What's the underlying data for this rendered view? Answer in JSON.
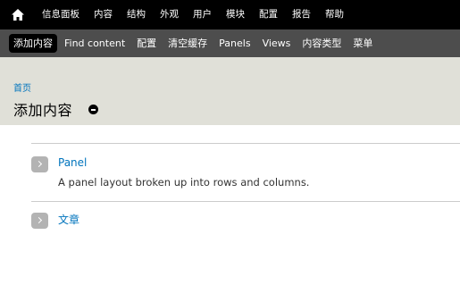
{
  "toolbar": {
    "home_icon": "home-icon",
    "items": [
      "信息面板",
      "内容",
      "结构",
      "外观",
      "用户",
      "模块",
      "配置",
      "报告",
      "帮助"
    ]
  },
  "shortcuts": {
    "items": [
      "添加内容",
      "Find content",
      "配置",
      "清空缓存",
      "Panels",
      "Views",
      "内容类型",
      "菜单"
    ],
    "active_index": 0
  },
  "header": {
    "breadcrumb": "首页",
    "title": "添加内容",
    "shortcut_icon": "remove-shortcut-icon"
  },
  "content": {
    "items": [
      {
        "title": "Panel",
        "description": "A panel layout broken up into rows and columns."
      },
      {
        "title": "文章",
        "description": ""
      }
    ]
  },
  "colors": {
    "toolbar_bg": "#000000",
    "shortcuts_bg": "#4d4d4d",
    "header_bg": "#e0e0d8",
    "link": "#0074bd"
  }
}
